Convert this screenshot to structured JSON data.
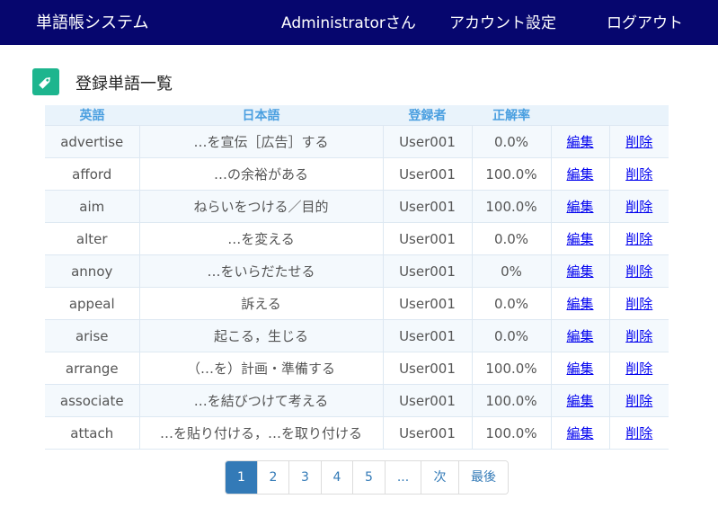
{
  "navbar": {
    "brand": "単語帳システム",
    "user": "Administratorさん",
    "account": "アカウント設定",
    "logout": "ログアウト"
  },
  "page": {
    "title": "登録単語一覧",
    "icon": "tag-icon",
    "accent_color": "#1db58e"
  },
  "table": {
    "headers": {
      "english": "英語",
      "japanese": "日本語",
      "registrant": "登録者",
      "accuracy": "正解率"
    },
    "rows": [
      {
        "english": "advertise",
        "japanese": "…を宣伝［広告］する",
        "registrant": "User001",
        "accuracy": "0.0%",
        "edit": "編集",
        "delete": "削除"
      },
      {
        "english": "afford",
        "japanese": "…の余裕がある",
        "registrant": "User001",
        "accuracy": "100.0%",
        "edit": "編集",
        "delete": "削除"
      },
      {
        "english": "aim",
        "japanese": "ねらいをつける／目的",
        "registrant": "User001",
        "accuracy": "100.0%",
        "edit": "編集",
        "delete": "削除"
      },
      {
        "english": "alter",
        "japanese": "…を変える",
        "registrant": "User001",
        "accuracy": "0.0%",
        "edit": "編集",
        "delete": "削除"
      },
      {
        "english": "annoy",
        "japanese": "…をいらだたせる",
        "registrant": "User001",
        "accuracy": "0%",
        "edit": "編集",
        "delete": "削除"
      },
      {
        "english": "appeal",
        "japanese": "訴える",
        "registrant": "User001",
        "accuracy": "0.0%",
        "edit": "編集",
        "delete": "削除"
      },
      {
        "english": "arise",
        "japanese": "起こる，生じる",
        "registrant": "User001",
        "accuracy": "0.0%",
        "edit": "編集",
        "delete": "削除"
      },
      {
        "english": "arrange",
        "japanese": "（…を）計画・準備する",
        "registrant": "User001",
        "accuracy": "100.0%",
        "edit": "編集",
        "delete": "削除"
      },
      {
        "english": "associate",
        "japanese": "…を結びつけて考える",
        "registrant": "User001",
        "accuracy": "100.0%",
        "edit": "編集",
        "delete": "削除"
      },
      {
        "english": "attach",
        "japanese": "…を貼り付ける，…を取り付ける",
        "registrant": "User001",
        "accuracy": "100.0%",
        "edit": "編集",
        "delete": "削除"
      }
    ]
  },
  "pagination": {
    "pages": [
      "1",
      "2",
      "3",
      "4",
      "5",
      "...",
      "次",
      "最後"
    ],
    "active": "1"
  }
}
